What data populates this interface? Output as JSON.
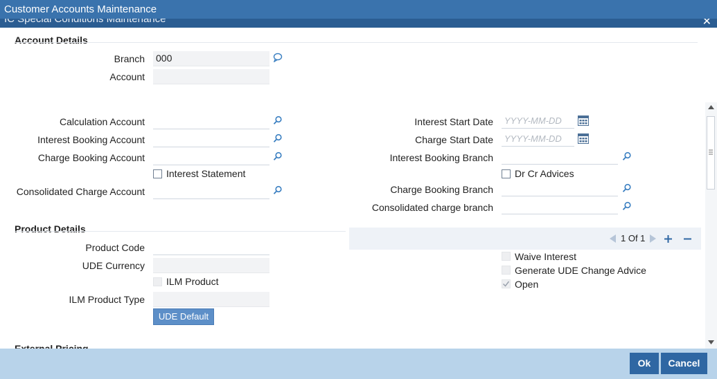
{
  "window": {
    "title": "Customer Accounts Maintenance",
    "subtitle": "IC Special Conditions Maintenance",
    "close_glyph": "✕"
  },
  "account_details": {
    "heading": "Account Details",
    "branch_label": "Branch",
    "branch_value": "000",
    "account_label": "Account",
    "account_value": ""
  },
  "left_fields": {
    "calculation_account": "Calculation Account",
    "interest_booking_account": "Interest Booking Account",
    "charge_booking_account": "Charge Booking Account",
    "interest_statement": "Interest Statement",
    "consolidated_charge_account": "Consolidated Charge Account"
  },
  "right_fields": {
    "interest_start_date": "Interest Start Date",
    "charge_start_date": "Charge Start Date",
    "date_placeholder": "YYYY-MM-DD",
    "interest_booking_branch": "Interest Booking Branch",
    "dr_cr_advices": "Dr Cr Advices",
    "charge_booking_branch": "Charge Booking Branch",
    "consolidated_charge_branch": "Consolidated charge branch"
  },
  "product_details": {
    "heading": "Product Details",
    "product_code": "Product Code",
    "ude_currency": "UDE Currency",
    "ilm_product": "ILM Product",
    "ilm_product_type": "ILM Product Type",
    "ude_default": "UDE Default"
  },
  "pagination": {
    "text": "1 Of 1"
  },
  "options": {
    "waive_interest": "Waive Interest",
    "generate_ude": "Generate UDE Change Advice",
    "open": "Open",
    "open_checked": true
  },
  "next_section": {
    "heading": "External Pricing"
  },
  "footer": {
    "ok": "Ok",
    "cancel": "Cancel"
  },
  "colors": {
    "title_bar": "#3a73ad",
    "footer": "#b8d3ea",
    "button": "#2f67a3"
  }
}
